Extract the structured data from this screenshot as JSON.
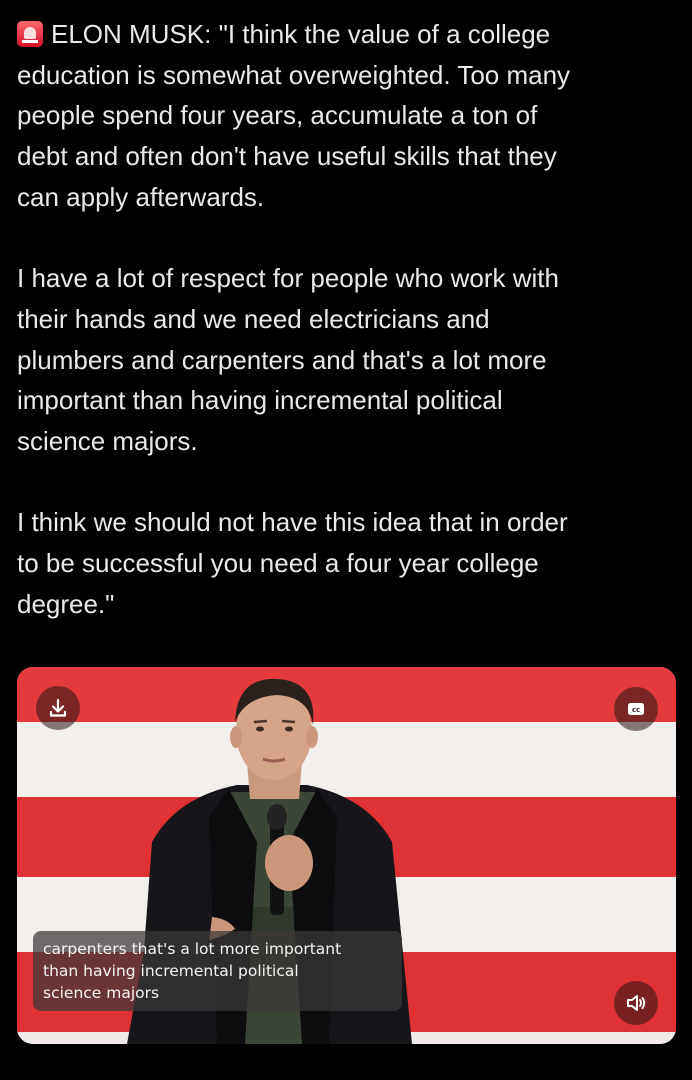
{
  "post": {
    "emoji_icon": "rotating-light-icon",
    "paragraphs": [
      [
        "ELON MUSK: \"I think the value of a college",
        "education is somewhat overweighted. Too many",
        "people spend four years, accumulate a ton of",
        "debt and often don't have useful skills that they",
        "can apply afterwards."
      ],
      [
        "I have a lot of respect for people who work with",
        "their hands and we need electricians and",
        "plumbers and carpenters and that's a lot more",
        "important than having incremental political",
        "science majors."
      ],
      [
        "I think we should not have this idea that in order",
        "to be successful you need a four year college",
        "degree.\""
      ]
    ]
  },
  "video": {
    "controls": {
      "download_icon": "download-icon",
      "cc_icon": "closed-captions-icon",
      "cc_label": "cc",
      "volume_icon": "volume-icon"
    },
    "caption_lines": [
      "carpenters that's a lot more important",
      "than having incremental political",
      "science majors"
    ]
  },
  "colors": {
    "background": "#000000",
    "text": "#e7e9ea",
    "flag_red": "#e23a3d",
    "flag_white": "#f3efed"
  }
}
